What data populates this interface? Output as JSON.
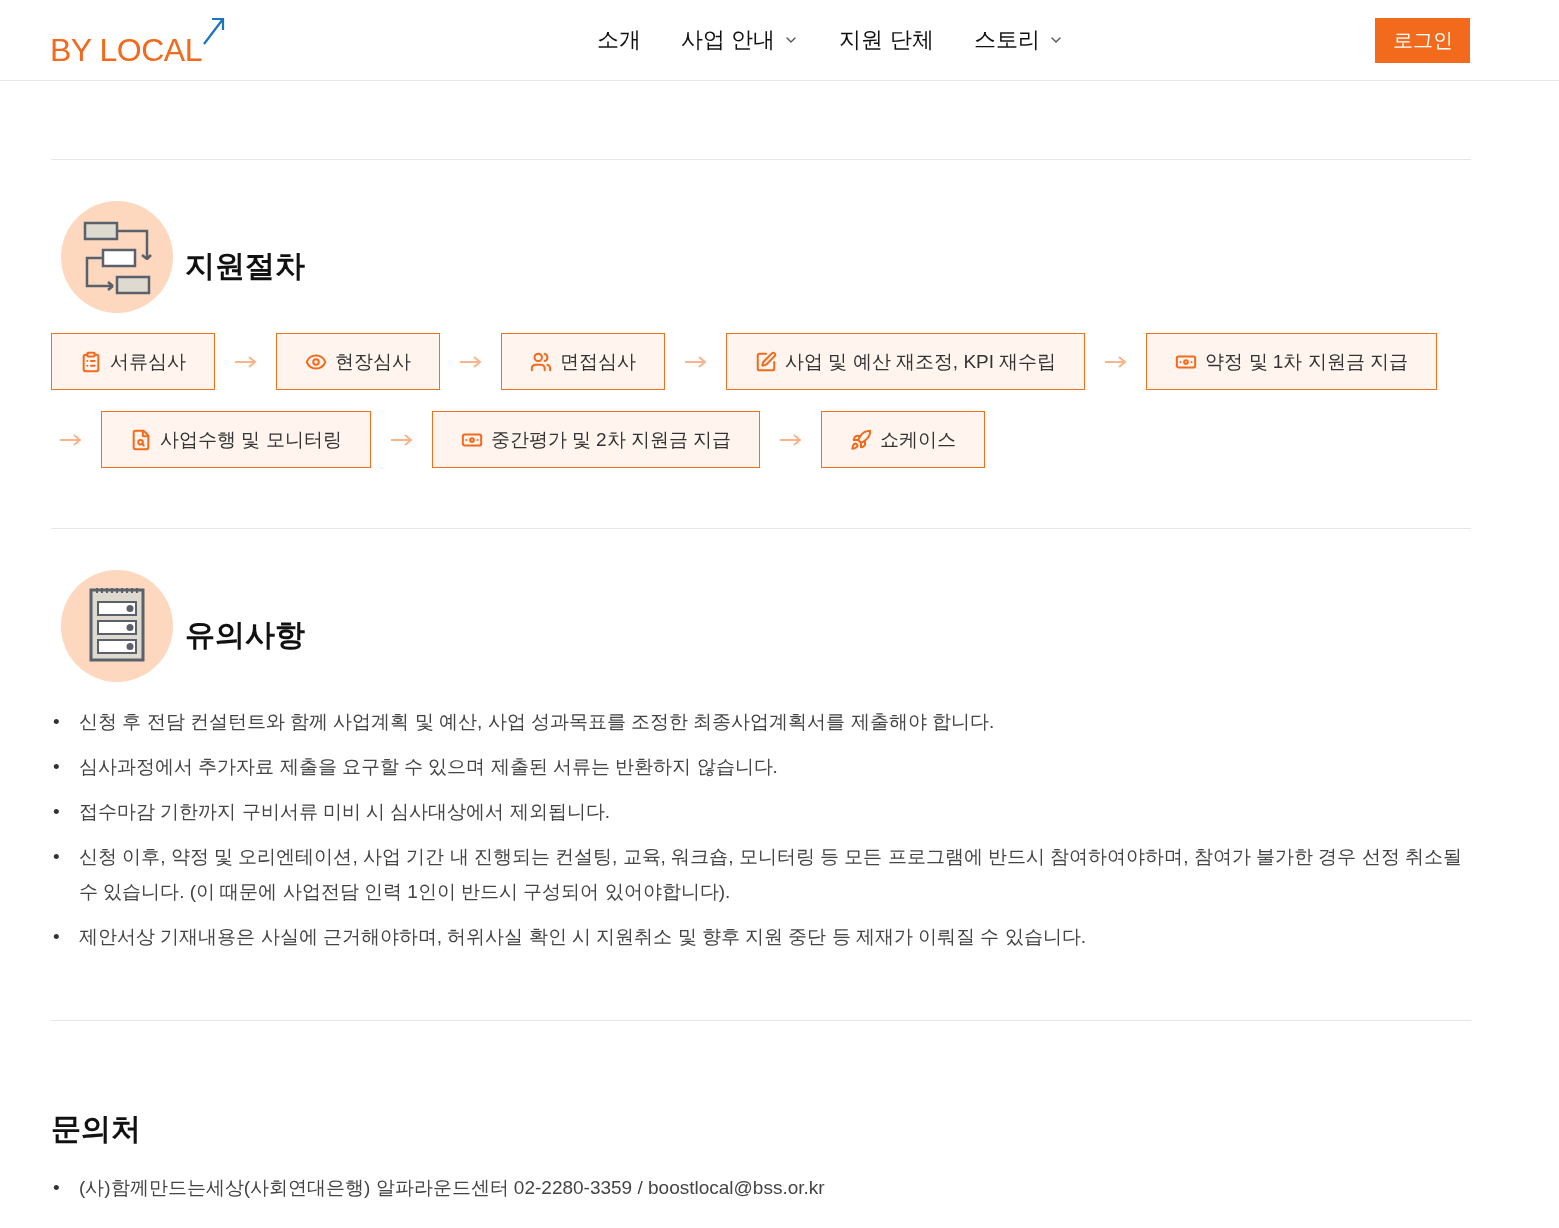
{
  "header": {
    "logo": "BY LOCAL",
    "nav": [
      {
        "label": "소개",
        "has_dropdown": false
      },
      {
        "label": "사업 안내",
        "has_dropdown": true
      },
      {
        "label": "지원 단체",
        "has_dropdown": false
      },
      {
        "label": "스토리",
        "has_dropdown": true
      }
    ],
    "login_button": "로그인"
  },
  "procedure": {
    "title": "지원절차",
    "rows": [
      [
        {
          "kind": "step",
          "label": "서류심사"
        },
        {
          "kind": "arrow"
        },
        {
          "kind": "step",
          "label": "현장심사"
        },
        {
          "kind": "arrow"
        },
        {
          "kind": "step",
          "label": "면접심사"
        },
        {
          "kind": "arrow"
        },
        {
          "kind": "step",
          "label": "사업 및 예산 재조정, KPI 재수립"
        },
        {
          "kind": "arrow"
        },
        {
          "kind": "step",
          "label": "약정 및 1차 지원금 지급"
        }
      ],
      [
        {
          "kind": "arrow"
        },
        {
          "kind": "step",
          "label": "사업수행 및 모니터링"
        },
        {
          "kind": "arrow"
        },
        {
          "kind": "step",
          "label": "중간평가 및 2차 지원금 지급"
        },
        {
          "kind": "arrow"
        },
        {
          "kind": "step",
          "label": "쇼케이스"
        }
      ]
    ]
  },
  "notes": {
    "title": "유의사항",
    "items": [
      {
        "bullet": "•",
        "text": "신청 후 전담 컨설턴트와 함께 사업계획 및 예산, 사업 성과목표를 조정한 최종사업계획서를 제출해야 합니다."
      },
      {
        "bullet": "•",
        "text": "심사과정에서 추가자료 제출을 요구할 수 있으며 제출된 서류는 반환하지 않습니다."
      },
      {
        "bullet": "•",
        "text": "접수마감 기한까지 구비서류 미비 시 심사대상에서 제외됩니다."
      },
      {
        "bullet": "•",
        "text": "신청 이후, 약정 및 오리엔테이션, 사업 기간 내 진행되는 컨설팅, 교육, 워크숍, 모니터링 등 모든 프로그램에 반드시 참여하여야하며, 참여가 불가한 경우 선정 취소될 수 있습니다. (이 때문에 사업전담 인력 1인이 반드시 구성되어 있어야합니다)."
      },
      {
        "bullet": "•",
        "text": "제안서상 기재내용은 사실에 근거해야하며, 허위사실 확인 시 지원취소 및 향후 지원 중단 등 제재가 이뤄질 수 있습니다."
      }
    ]
  },
  "contact": {
    "title": "문의처",
    "items": [
      {
        "bullet": "•",
        "text": "(사)함께만드는세상(사회연대은행) 알파라운드센터 02-2280-3359 / boostlocal@bss.or.kr"
      }
    ]
  }
}
